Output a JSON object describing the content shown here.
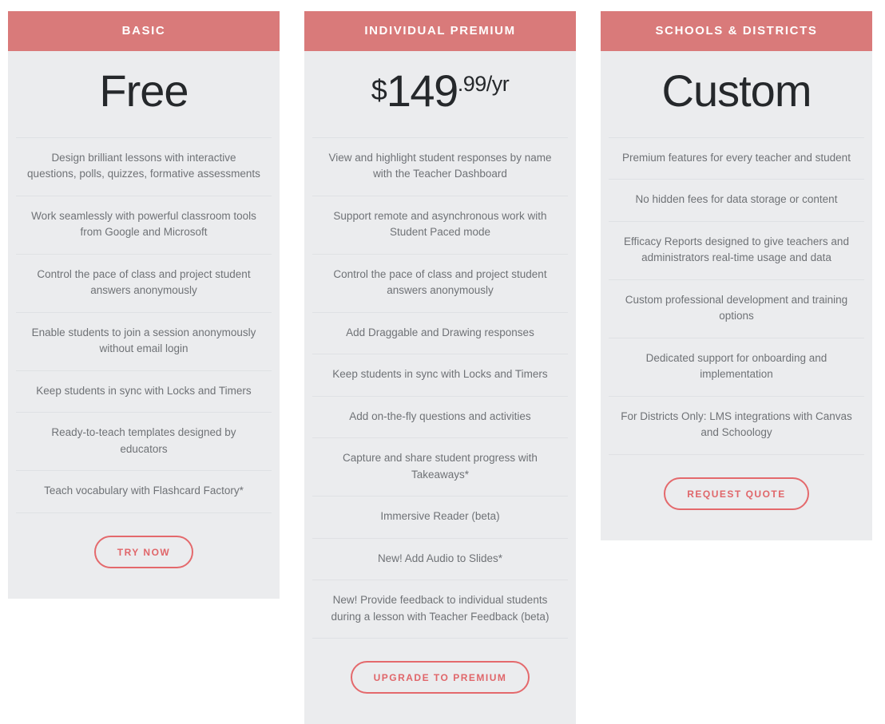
{
  "plans": [
    {
      "name": "BASIC",
      "price": {
        "type": "word",
        "word": "Free",
        "currency": "",
        "amount": "",
        "suffix": ""
      },
      "features": [
        "Design brilliant lessons with interactive questions, polls, quizzes, formative assessments",
        "Work seamlessly with powerful classroom tools from Google and Microsoft",
        "Control the pace of class and project student answers anonymously",
        "Enable students to join a session anonymously without email login",
        "Keep students in sync with Locks and Timers",
        "Ready-to-teach templates designed by educators",
        "Teach vocabulary with Flashcard Factory*"
      ],
      "cta_label": "TRY NOW"
    },
    {
      "name": "INDIVIDUAL PREMIUM",
      "price": {
        "type": "amount",
        "word": "",
        "currency": "$",
        "amount": "149",
        "suffix": ".99/yr"
      },
      "features": [
        "View and highlight student responses by name with the Teacher Dashboard",
        "Support remote and asynchronous work with Student Paced mode",
        "Control the pace of class and project student answers anonymously",
        "Add Draggable and Drawing responses",
        "Keep students in sync with Locks and Timers",
        "Add on-the-fly questions and activities",
        "Capture and share student progress with Takeaways*",
        "Immersive Reader (beta)",
        "New! Add Audio to Slides*",
        "New! Provide feedback to individual students during a lesson with Teacher Feedback (beta)"
      ],
      "cta_label": "UPGRADE TO PREMIUM"
    },
    {
      "name": "SCHOOLS & DISTRICTS",
      "price": {
        "type": "word",
        "word": "Custom",
        "currency": "",
        "amount": "",
        "suffix": ""
      },
      "features": [
        "Premium features for every teacher and student",
        "No hidden fees for data storage or content",
        "Efficacy Reports designed to give teachers and administrators real-time usage and data",
        "Custom professional development and training options",
        "Dedicated support for onboarding and implementation",
        "For Districts Only: LMS integrations with Canvas and Schoology"
      ],
      "cta_label": "REQUEST QUOTE"
    }
  ],
  "colors": {
    "header_band": "#d97a7a",
    "card_background": "#ebecee",
    "cta_border": "#e4696c",
    "cta_text": "#e0666a",
    "feature_text": "#6f7276",
    "price_text": "#25282b",
    "divider": "#dfe1e4"
  }
}
